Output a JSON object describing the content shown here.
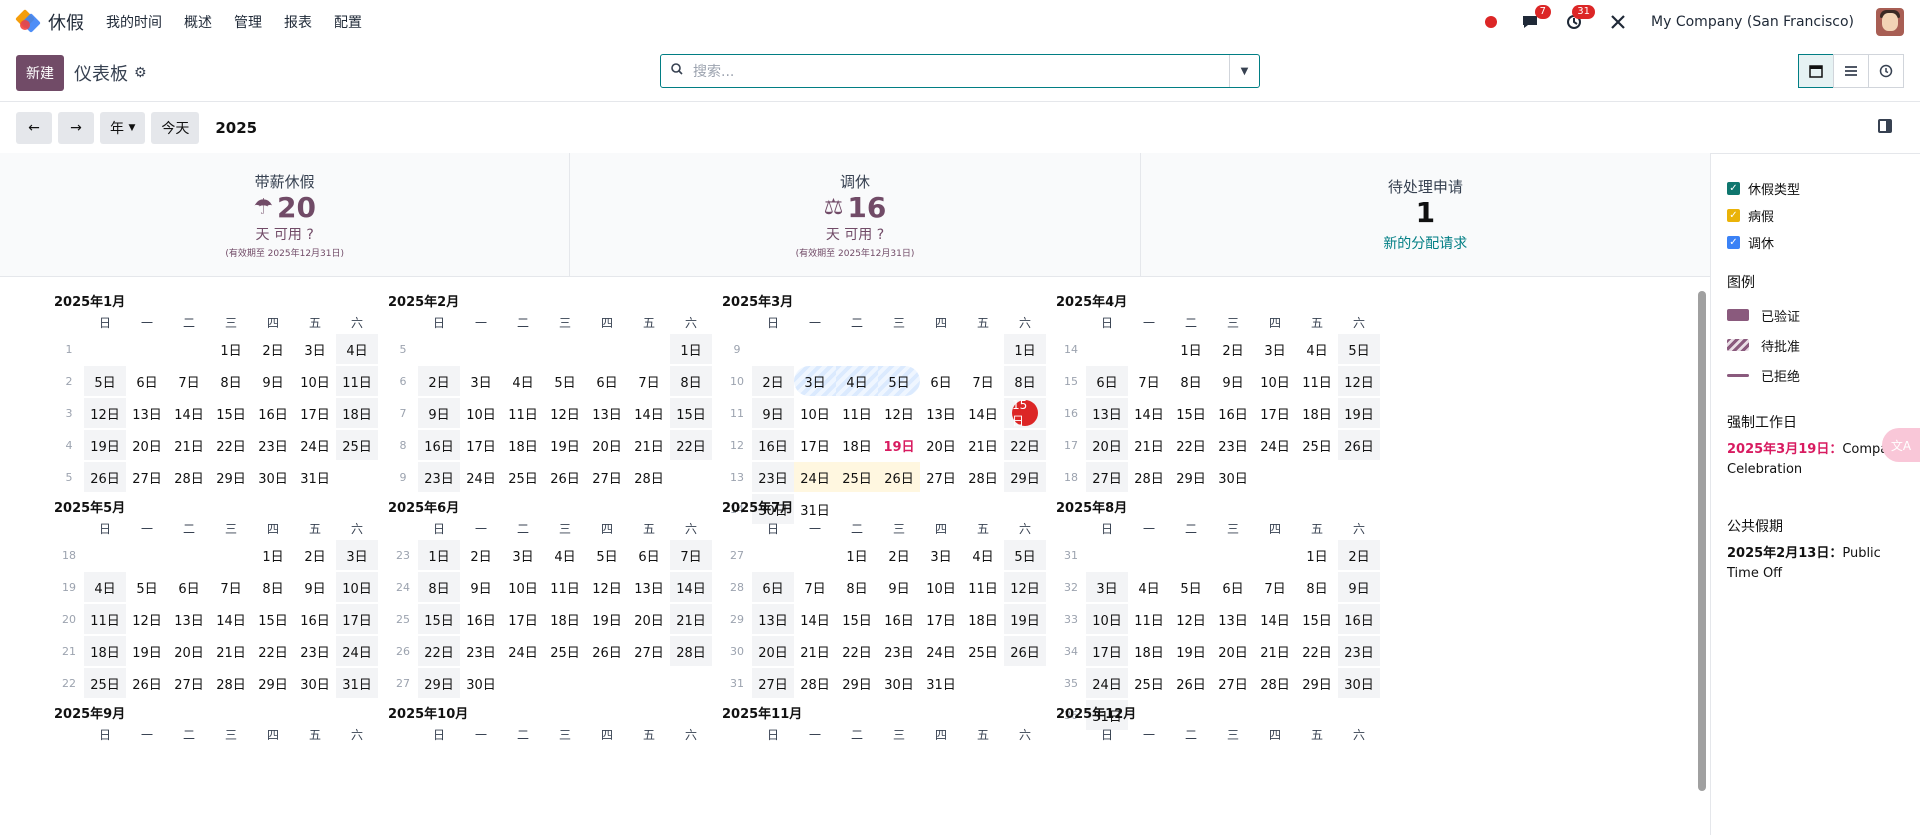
{
  "topbar": {
    "app_name": "休假",
    "menu": [
      "我的时间",
      "概述",
      "管理",
      "报表",
      "配置"
    ],
    "messages_badge": "7",
    "activities_badge": "31",
    "company": "My Company (San Francisco)"
  },
  "control": {
    "new_label": "新建",
    "title": "仪表板",
    "search_placeholder": "搜索..."
  },
  "nav": {
    "scale_label": "年",
    "today_label": "今天",
    "year": "2025"
  },
  "stats": [
    {
      "name": "带薪休假",
      "value": "20",
      "unit": "天 可用",
      "valid": "(有效期至 2025年12月31日)"
    },
    {
      "name": "调休",
      "value": "16",
      "unit": "天 可用",
      "valid": "(有效期至 2025年12月31日)"
    },
    {
      "name": "待处理申请",
      "value": "1",
      "link": "新的分配请求"
    }
  ],
  "calendar": {
    "dow": [
      "日",
      "一",
      "二",
      "三",
      "四",
      "五",
      "六"
    ],
    "months": [
      {
        "title": "2025年1月",
        "weeks": [
          [
            1,
            [
              "",
              "",
              "",
              "1日",
              "2日",
              "3日",
              "4日"
            ]
          ],
          [
            2,
            [
              "5日",
              "6日",
              "7日",
              "8日",
              "9日",
              "10日",
              "11日"
            ]
          ],
          [
            3,
            [
              "12日",
              "13日",
              "14日",
              "15日",
              "16日",
              "17日",
              "18日"
            ]
          ],
          [
            4,
            [
              "19日",
              "20日",
              "21日",
              "22日",
              "23日",
              "24日",
              "25日"
            ]
          ],
          [
            5,
            [
              "26日",
              "27日",
              "28日",
              "29日",
              "30日",
              "31日",
              ""
            ]
          ]
        ]
      },
      {
        "title": "2025年2月",
        "weeks": [
          [
            5,
            [
              "",
              "",
              "",
              "",
              "",
              "",
              "1日"
            ]
          ],
          [
            6,
            [
              "2日",
              "3日",
              "4日",
              "5日",
              "6日",
              "7日",
              "8日"
            ]
          ],
          [
            7,
            [
              "9日",
              "10日",
              "11日",
              "12日",
              "13日",
              "14日",
              "15日"
            ]
          ],
          [
            8,
            [
              "16日",
              "17日",
              "18日",
              "19日",
              "20日",
              "21日",
              "22日"
            ]
          ],
          [
            9,
            [
              "23日",
              "24日",
              "25日",
              "26日",
              "27日",
              "28日",
              ""
            ]
          ]
        ]
      },
      {
        "title": "2025年3月",
        "weeks": [
          [
            9,
            [
              "",
              "",
              "",
              "",
              "",
              "",
              "1日"
            ]
          ],
          [
            10,
            [
              "2日",
              "3日",
              "4日",
              "5日",
              "6日",
              "7日",
              "8日"
            ]
          ],
          [
            11,
            [
              "9日",
              "10日",
              "11日",
              "12日",
              "13日",
              "14日",
              "15日"
            ]
          ],
          [
            12,
            [
              "16日",
              "17日",
              "18日",
              "19日",
              "20日",
              "21日",
              "22日"
            ]
          ],
          [
            13,
            [
              "23日",
              "24日",
              "25日",
              "26日",
              "27日",
              "28日",
              "29日"
            ]
          ],
          [
            14,
            [
              "30日",
              "31日",
              "",
              "",
              "",
              "",
              ""
            ]
          ]
        ]
      },
      {
        "title": "2025年4月",
        "weeks": [
          [
            14,
            [
              "",
              "",
              "1日",
              "2日",
              "3日",
              "4日",
              "5日"
            ]
          ],
          [
            15,
            [
              "6日",
              "7日",
              "8日",
              "9日",
              "10日",
              "11日",
              "12日"
            ]
          ],
          [
            16,
            [
              "13日",
              "14日",
              "15日",
              "16日",
              "17日",
              "18日",
              "19日"
            ]
          ],
          [
            17,
            [
              "20日",
              "21日",
              "22日",
              "23日",
              "24日",
              "25日",
              "26日"
            ]
          ],
          [
            18,
            [
              "27日",
              "28日",
              "29日",
              "30日",
              "",
              "",
              ""
            ]
          ]
        ]
      },
      {
        "title": "2025年5月",
        "weeks": [
          [
            18,
            [
              "",
              "",
              "",
              "",
              "1日",
              "2日",
              "3日"
            ]
          ],
          [
            19,
            [
              "4日",
              "5日",
              "6日",
              "7日",
              "8日",
              "9日",
              "10日"
            ]
          ],
          [
            20,
            [
              "11日",
              "12日",
              "13日",
              "14日",
              "15日",
              "16日",
              "17日"
            ]
          ],
          [
            21,
            [
              "18日",
              "19日",
              "20日",
              "21日",
              "22日",
              "23日",
              "24日"
            ]
          ],
          [
            22,
            [
              "25日",
              "26日",
              "27日",
              "28日",
              "29日",
              "30日",
              "31日"
            ]
          ]
        ]
      },
      {
        "title": "2025年6月",
        "weeks": [
          [
            23,
            [
              "1日",
              "2日",
              "3日",
              "4日",
              "5日",
              "6日",
              "7日"
            ]
          ],
          [
            24,
            [
              "8日",
              "9日",
              "10日",
              "11日",
              "12日",
              "13日",
              "14日"
            ]
          ],
          [
            25,
            [
              "15日",
              "16日",
              "17日",
              "18日",
              "19日",
              "20日",
              "21日"
            ]
          ],
          [
            26,
            [
              "22日",
              "23日",
              "24日",
              "25日",
              "26日",
              "27日",
              "28日"
            ]
          ],
          [
            27,
            [
              "29日",
              "30日",
              "",
              "",
              "",
              "",
              ""
            ]
          ]
        ]
      },
      {
        "title": "2025年7月",
        "weeks": [
          [
            27,
            [
              "",
              "",
              "1日",
              "2日",
              "3日",
              "4日",
              "5日"
            ]
          ],
          [
            28,
            [
              "6日",
              "7日",
              "8日",
              "9日",
              "10日",
              "11日",
              "12日"
            ]
          ],
          [
            29,
            [
              "13日",
              "14日",
              "15日",
              "16日",
              "17日",
              "18日",
              "19日"
            ]
          ],
          [
            30,
            [
              "20日",
              "21日",
              "22日",
              "23日",
              "24日",
              "25日",
              "26日"
            ]
          ],
          [
            31,
            [
              "27日",
              "28日",
              "29日",
              "30日",
              "31日",
              "",
              ""
            ]
          ]
        ]
      },
      {
        "title": "2025年8月",
        "weeks": [
          [
            31,
            [
              "",
              "",
              "",
              "",
              "",
              "1日",
              "2日"
            ]
          ],
          [
            32,
            [
              "3日",
              "4日",
              "5日",
              "6日",
              "7日",
              "8日",
              "9日"
            ]
          ],
          [
            33,
            [
              "10日",
              "11日",
              "12日",
              "13日",
              "14日",
              "15日",
              "16日"
            ]
          ],
          [
            34,
            [
              "17日",
              "18日",
              "19日",
              "20日",
              "21日",
              "22日",
              "23日"
            ]
          ],
          [
            35,
            [
              "24日",
              "25日",
              "26日",
              "27日",
              "28日",
              "29日",
              "30日"
            ]
          ],
          [
            36,
            [
              "31日",
              "",
              "",
              "",
              "",
              "",
              ""
            ]
          ]
        ]
      },
      {
        "title": "2025年9月",
        "weeks": []
      },
      {
        "title": "2025年10月",
        "weeks": []
      },
      {
        "title": "2025年11月",
        "weeks": []
      },
      {
        "title": "2025年12月",
        "weeks": []
      }
    ]
  },
  "sidebar": {
    "filters": [
      {
        "label": "休假类型",
        "color": "#0f766e"
      },
      {
        "label": "病假",
        "color": "#eab308"
      },
      {
        "label": "调休",
        "color": "#3b82f6"
      }
    ],
    "legend_title": "图例",
    "legend": [
      "已验证",
      "待批准",
      "已拒绝"
    ],
    "mandatory_title": "强制工作日",
    "mandatory_date": "2025年3月19日",
    "mandatory_name": "Company Celebration",
    "public_title": "公共假期",
    "public_date": "2025年2月13日",
    "public_name": "Public Time Off"
  }
}
